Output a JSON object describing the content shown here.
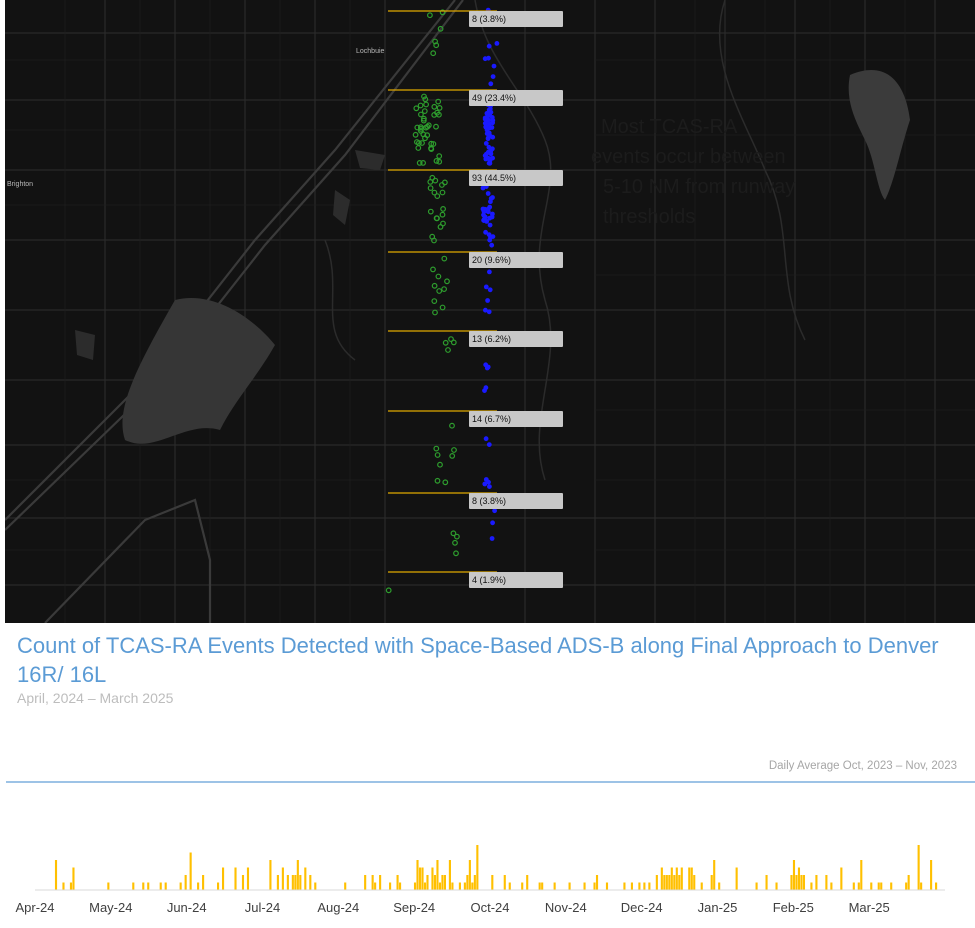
{
  "map": {
    "places": [
      "Lochbuie",
      "Brighton"
    ],
    "ghost_annotation": [
      "Most TCAS-RA",
      "events occur between",
      "5-10 NM from runway",
      "thresholds"
    ],
    "bins": [
      {
        "label": "8 (3.8%)"
      },
      {
        "label": "49 (23.4%)"
      },
      {
        "label": "93 (44.5%)"
      },
      {
        "label": "20 (9.6%)"
      },
      {
        "label": "13 (6.2%)"
      },
      {
        "label": "14 (6.7%)"
      },
      {
        "label": "8 (3.8%)"
      },
      {
        "label": "4 (1.9%)"
      }
    ],
    "colors": {
      "background": "#121212",
      "left_runway": "#2e9e2e",
      "right_runway": "#1a1aff",
      "bin_line": "#e0a800",
      "label_bg": "#c8c8c8"
    }
  },
  "header": {
    "title": "Count of TCAS-RA Events Detected with Space-Based ADS-B along Final Approach to Denver 16R/ 16L",
    "subtitle": "April, 2024 – March 2025"
  },
  "reference": {
    "label": "Daily Average Oct, 2023 – Nov, 2023",
    "color": "#9dc3e6"
  },
  "chart_data": {
    "type": "bar",
    "color": "#ffc000",
    "x_tick_labels": [
      "Apr-24",
      "May-24",
      "Jun-24",
      "Jul-24",
      "Aug-24",
      "Sep-24",
      "Oct-24",
      "Nov-24",
      "Dec-24",
      "Jan-25",
      "Feb-25",
      "Mar-25"
    ],
    "x_range": [
      "2024-04-01",
      "2025-03-31"
    ],
    "y_range": [
      0,
      4
    ],
    "bars": [
      {
        "date": "2024-04-09",
        "value": 2
      },
      {
        "date": "2024-04-12",
        "value": 0.5
      },
      {
        "date": "2024-04-15",
        "value": 0.5
      },
      {
        "date": "2024-04-16",
        "value": 1.5
      },
      {
        "date": "2024-04-30",
        "value": 0.5
      },
      {
        "date": "2024-05-10",
        "value": 0.5
      },
      {
        "date": "2024-05-14",
        "value": 0.5
      },
      {
        "date": "2024-05-16",
        "value": 0.5
      },
      {
        "date": "2024-05-21",
        "value": 0.5
      },
      {
        "date": "2024-05-23",
        "value": 0.5
      },
      {
        "date": "2024-05-29",
        "value": 0.5
      },
      {
        "date": "2024-05-31",
        "value": 1
      },
      {
        "date": "2024-06-02",
        "value": 2.5
      },
      {
        "date": "2024-06-05",
        "value": 0.5
      },
      {
        "date": "2024-06-07",
        "value": 1
      },
      {
        "date": "2024-06-13",
        "value": 0.5
      },
      {
        "date": "2024-06-15",
        "value": 1.5
      },
      {
        "date": "2024-06-20",
        "value": 1.5
      },
      {
        "date": "2024-06-23",
        "value": 1
      },
      {
        "date": "2024-06-25",
        "value": 1.5
      },
      {
        "date": "2024-07-04",
        "value": 2
      },
      {
        "date": "2024-07-07",
        "value": 1
      },
      {
        "date": "2024-07-09",
        "value": 1.5
      },
      {
        "date": "2024-07-11",
        "value": 1
      },
      {
        "date": "2024-07-13",
        "value": 1
      },
      {
        "date": "2024-07-14",
        "value": 1
      },
      {
        "date": "2024-07-15",
        "value": 2
      },
      {
        "date": "2024-07-16",
        "value": 1
      },
      {
        "date": "2024-07-18",
        "value": 1.5
      },
      {
        "date": "2024-07-20",
        "value": 1
      },
      {
        "date": "2024-07-22",
        "value": 0.5
      },
      {
        "date": "2024-08-03",
        "value": 0.5
      },
      {
        "date": "2024-08-11",
        "value": 1
      },
      {
        "date": "2024-08-14",
        "value": 1
      },
      {
        "date": "2024-08-15",
        "value": 0.5
      },
      {
        "date": "2024-08-17",
        "value": 1
      },
      {
        "date": "2024-08-21",
        "value": 0.5
      },
      {
        "date": "2024-08-24",
        "value": 1
      },
      {
        "date": "2024-08-25",
        "value": 0.5
      },
      {
        "date": "2024-08-31",
        "value": 0.5
      },
      {
        "date": "2024-09-01",
        "value": 2
      },
      {
        "date": "2024-09-02",
        "value": 1.5
      },
      {
        "date": "2024-09-03",
        "value": 1.5
      },
      {
        "date": "2024-09-04",
        "value": 0.5
      },
      {
        "date": "2024-09-05",
        "value": 1
      },
      {
        "date": "2024-09-07",
        "value": 1.5
      },
      {
        "date": "2024-09-08",
        "value": 1
      },
      {
        "date": "2024-09-09",
        "value": 2
      },
      {
        "date": "2024-09-10",
        "value": 0.5
      },
      {
        "date": "2024-09-11",
        "value": 1
      },
      {
        "date": "2024-09-12",
        "value": 1
      },
      {
        "date": "2024-09-14",
        "value": 2
      },
      {
        "date": "2024-09-15",
        "value": 0.5
      },
      {
        "date": "2024-09-18",
        "value": 0.5
      },
      {
        "date": "2024-09-20",
        "value": 0.5
      },
      {
        "date": "2024-09-21",
        "value": 1
      },
      {
        "date": "2024-09-22",
        "value": 2
      },
      {
        "date": "2024-09-23",
        "value": 0.5
      },
      {
        "date": "2024-09-24",
        "value": 1
      },
      {
        "date": "2024-09-25",
        "value": 3
      },
      {
        "date": "2024-10-01",
        "value": 1
      },
      {
        "date": "2024-10-06",
        "value": 1
      },
      {
        "date": "2024-10-08",
        "value": 0.5
      },
      {
        "date": "2024-10-13",
        "value": 0.5
      },
      {
        "date": "2024-10-15",
        "value": 1
      },
      {
        "date": "2024-10-20",
        "value": 0.5
      },
      {
        "date": "2024-10-21",
        "value": 0.5
      },
      {
        "date": "2024-10-26",
        "value": 0.5
      },
      {
        "date": "2024-11-01",
        "value": 0.5
      },
      {
        "date": "2024-11-07",
        "value": 0.5
      },
      {
        "date": "2024-11-11",
        "value": 0.5
      },
      {
        "date": "2024-11-12",
        "value": 1
      },
      {
        "date": "2024-11-16",
        "value": 0.5
      },
      {
        "date": "2024-11-23",
        "value": 0.5
      },
      {
        "date": "2024-11-26",
        "value": 0.5
      },
      {
        "date": "2024-11-29",
        "value": 0.5
      },
      {
        "date": "2024-12-01",
        "value": 0.5
      },
      {
        "date": "2024-12-03",
        "value": 0.5
      },
      {
        "date": "2024-12-06",
        "value": 1
      },
      {
        "date": "2024-12-08",
        "value": 1.5
      },
      {
        "date": "2024-12-09",
        "value": 1
      },
      {
        "date": "2024-12-10",
        "value": 1
      },
      {
        "date": "2024-12-11",
        "value": 1
      },
      {
        "date": "2024-12-12",
        "value": 1.5
      },
      {
        "date": "2024-12-13",
        "value": 1
      },
      {
        "date": "2024-12-14",
        "value": 1.5
      },
      {
        "date": "2024-12-15",
        "value": 1
      },
      {
        "date": "2024-12-16",
        "value": 1.5
      },
      {
        "date": "2024-12-19",
        "value": 1.5
      },
      {
        "date": "2024-12-20",
        "value": 1.5
      },
      {
        "date": "2024-12-21",
        "value": 1
      },
      {
        "date": "2024-12-24",
        "value": 0.5
      },
      {
        "date": "2024-12-28",
        "value": 1
      },
      {
        "date": "2024-12-29",
        "value": 2
      },
      {
        "date": "2024-12-31",
        "value": 0.5
      },
      {
        "date": "2025-01-07",
        "value": 1.5
      },
      {
        "date": "2025-01-15",
        "value": 0.5
      },
      {
        "date": "2025-01-19",
        "value": 1
      },
      {
        "date": "2025-01-23",
        "value": 0.5
      },
      {
        "date": "2025-01-29",
        "value": 1
      },
      {
        "date": "2025-01-30",
        "value": 2
      },
      {
        "date": "2025-01-31",
        "value": 1
      },
      {
        "date": "2025-02-01",
        "value": 1.5
      },
      {
        "date": "2025-02-02",
        "value": 1
      },
      {
        "date": "2025-02-03",
        "value": 1
      },
      {
        "date": "2025-02-06",
        "value": 0.5
      },
      {
        "date": "2025-02-08",
        "value": 1
      },
      {
        "date": "2025-02-12",
        "value": 1
      },
      {
        "date": "2025-02-14",
        "value": 0.5
      },
      {
        "date": "2025-02-18",
        "value": 1.5
      },
      {
        "date": "2025-02-23",
        "value": 0.5
      },
      {
        "date": "2025-02-25",
        "value": 0.5
      },
      {
        "date": "2025-02-26",
        "value": 2
      },
      {
        "date": "2025-03-02",
        "value": 0.5
      },
      {
        "date": "2025-03-05",
        "value": 0.5
      },
      {
        "date": "2025-03-06",
        "value": 0.5
      },
      {
        "date": "2025-03-10",
        "value": 0.5
      },
      {
        "date": "2025-03-16",
        "value": 0.5
      },
      {
        "date": "2025-03-17",
        "value": 1
      },
      {
        "date": "2025-03-21",
        "value": 3
      },
      {
        "date": "2025-03-22",
        "value": 0.5
      },
      {
        "date": "2025-03-26",
        "value": 2
      },
      {
        "date": "2025-03-28",
        "value": 0.5
      }
    ]
  }
}
